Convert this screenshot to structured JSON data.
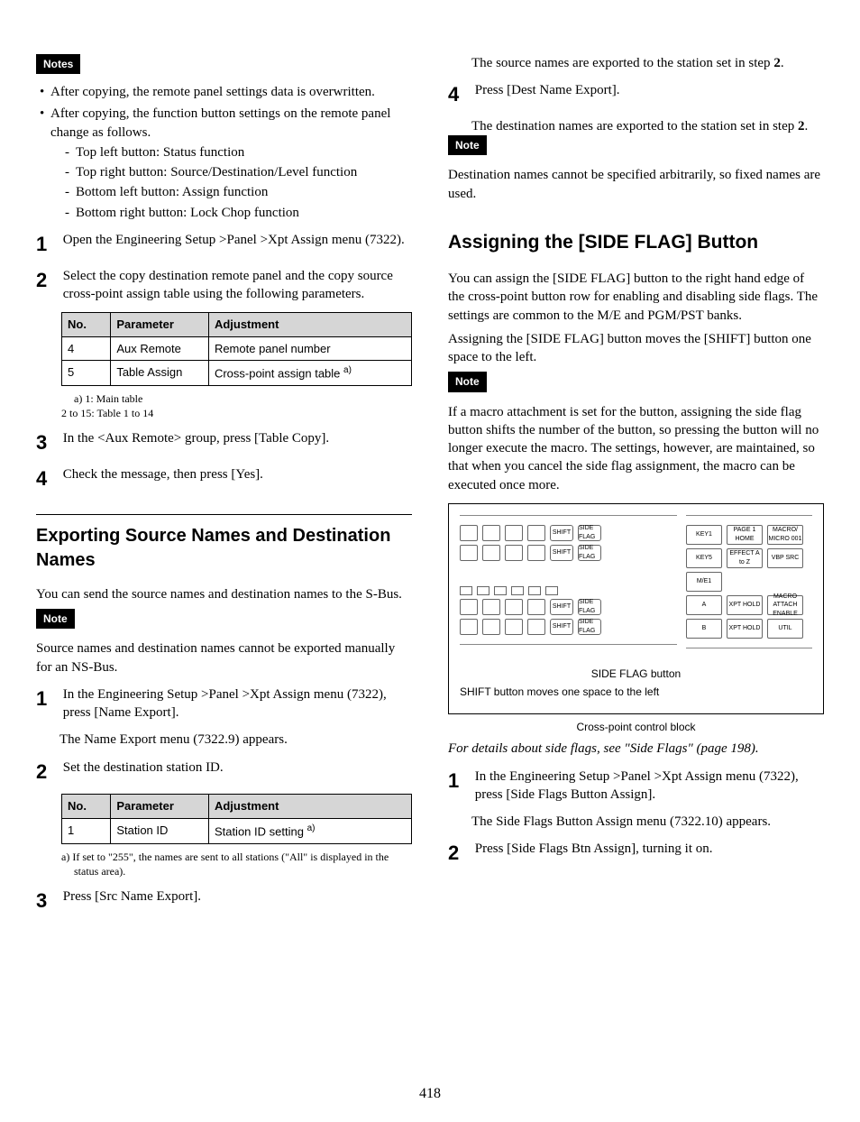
{
  "page_number": "418",
  "colL": {
    "notes_label": "Notes",
    "bullet1": "After copying, the remote panel settings data is overwritten.",
    "bullet2": "After copying, the function button settings on the remote panel change as follows.",
    "dash1": "Top left button: Status function",
    "dash2": "Top right button: Source/Destination/Level function",
    "dash3": "Bottom left button: Assign function",
    "dash4": "Bottom right button: Lock Chop function",
    "step1_num": "1",
    "step1": "Open the Engineering Setup >Panel >Xpt Assign menu (7322).",
    "step2_num": "2",
    "step2": "Select the copy destination remote panel and the copy source cross-point assign table using the following parameters.",
    "table1": {
      "h1": "No.",
      "h2": "Parameter",
      "h3": "Adjustment",
      "r1c1": "4",
      "r1c2": "Aux Remote",
      "r1c3": "Remote panel number",
      "r2c1": "5",
      "r2c2": "Table Assign",
      "r2c3": "Cross-point assign table ",
      "r2c3_sup": "a)"
    },
    "fn1a": "a) 1: Main table",
    "fn1b": "2 to 15: Table 1 to 14",
    "step3_num": "3",
    "step3": "In the <Aux Remote> group, press [Table Copy].",
    "step4_num": "4",
    "step4": "Check the message, then press [Yes].",
    "h2a": "Exporting Source Names and Destination Names",
    "p_intro": "You can send the source names and destination names to the S-Bus.",
    "note2_label": "Note",
    "note2_text": "Source names and destination names cannot be exported manually for an NS-Bus.",
    "b1_num": "1",
    "b1": "In the Engineering Setup >Panel >Xpt Assign menu (7322), press [Name Export].",
    "b1_sub": "The Name Export menu (7322.9) appears.",
    "b2_num": "2",
    "b2": "Set the destination station ID.",
    "table2": {
      "h1": "No.",
      "h2": "Parameter",
      "h3": "Adjustment",
      "r1c1": "1",
      "r1c2": "Station ID",
      "r1c3": "Station ID setting ",
      "r1c3_sup": "a)"
    },
    "fn2": "a) If set to \"255\", the names are sent to all stations (\"All\" is displayed in the status area).",
    "b3_num": "3",
    "b3": "Press [Src Name Export]."
  },
  "colR": {
    "top1a": "The source names are exported to the station set in step ",
    "top1b": "2",
    "top1c": ".",
    "c4_num": "4",
    "c4": "Press [Dest Name Export].",
    "c4_sub_a": "The destination names are exported to the station set in step ",
    "c4_sub_b": "2",
    "c4_sub_c": ".",
    "note3_label": "Note",
    "note3_text": "Destination names cannot be specified arbitrarily, so fixed names are used.",
    "h2b": "Assigning the [SIDE FLAG] Button",
    "p1": "You can assign the [SIDE FLAG] button to the right hand edge of the cross-point button row for enabling and disabling side flags. The settings are common to the M/E and PGM/PST banks.",
    "p2": "Assigning the [SIDE FLAG] button moves the [SHIFT] button one space to the left.",
    "note4_label": "Note",
    "note4_text": "If a macro attachment is set for the button, assigning the side flag button shifts the number of the button, so pressing the button will no longer execute the macro. The settings, however, are maintained, so that when you cancel the side flag assignment, the macro can be executed once more.",
    "diagram": {
      "shift": "SHIFT",
      "side_flag": "SIDE FLAG",
      "key1": "KEY1",
      "key5": "KEY5",
      "me1": "M/E1",
      "a": "A",
      "b": "B",
      "page1_home": "PAGE 1 HOME",
      "macro_micro": "MACRO/ MICRO 001",
      "effect": "EFFECT A to Z",
      "vbp_src": "VBP SRC",
      "xpt_hold": "XPT HOLD",
      "macro_attach": "MACRO ATTACH ENABLE",
      "util": "UTIL",
      "cap1": "SIDE FLAG button",
      "cap2": "SHIFT button moves one space to the left"
    },
    "diagram_caption": "Cross-point control block",
    "ref": "For details about side flags, see \"Side Flags\" (page 198).",
    "d1_num": "1",
    "d1": "In the Engineering Setup >Panel >Xpt Assign menu (7322), press [Side Flags Button Assign].",
    "d1_sub": "The Side Flags Button Assign menu (7322.10) appears.",
    "d2_num": "2",
    "d2": "Press [Side Flags Btn Assign], turning it on."
  }
}
